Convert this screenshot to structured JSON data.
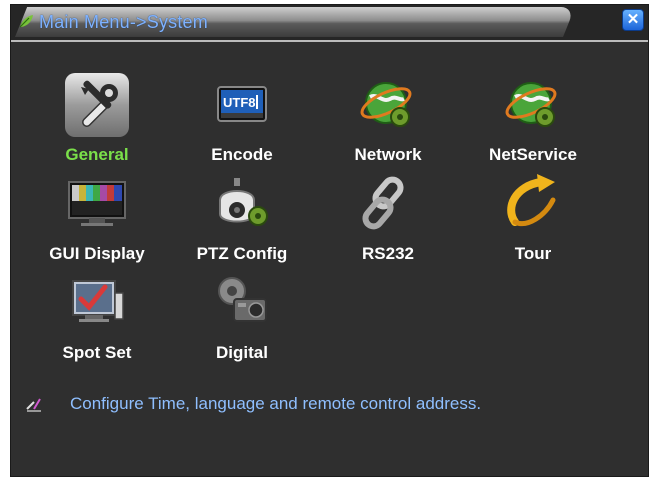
{
  "window": {
    "title": "Main Menu->System",
    "close_symbol": "✕"
  },
  "menu": {
    "items": [
      {
        "label": "General",
        "icon": "tools-icon",
        "selected": true
      },
      {
        "label": "Encode",
        "icon": "utf8-chip-icon",
        "chip_text": "UTF8"
      },
      {
        "label": "Network",
        "icon": "globe-gear-icon"
      },
      {
        "label": "NetService",
        "icon": "globe-gear-icon"
      },
      {
        "label": "GUI Display",
        "icon": "monitor-icon"
      },
      {
        "label": "PTZ Config",
        "icon": "camera-gear-icon"
      },
      {
        "label": "RS232",
        "icon": "chain-link-icon"
      },
      {
        "label": "Tour",
        "icon": "tour-arrow-icon"
      },
      {
        "label": "Spot Set",
        "icon": "spot-monitor-icon"
      },
      {
        "label": "Digital",
        "icon": "digital-camera-gear-icon"
      }
    ]
  },
  "status": {
    "text": "Configure Time, language and remote control address."
  },
  "colors": {
    "background": "#2f2f2f",
    "selected_label": "#7be04a",
    "title_text": "#7fb2ff",
    "status_text": "#8fbfff"
  }
}
